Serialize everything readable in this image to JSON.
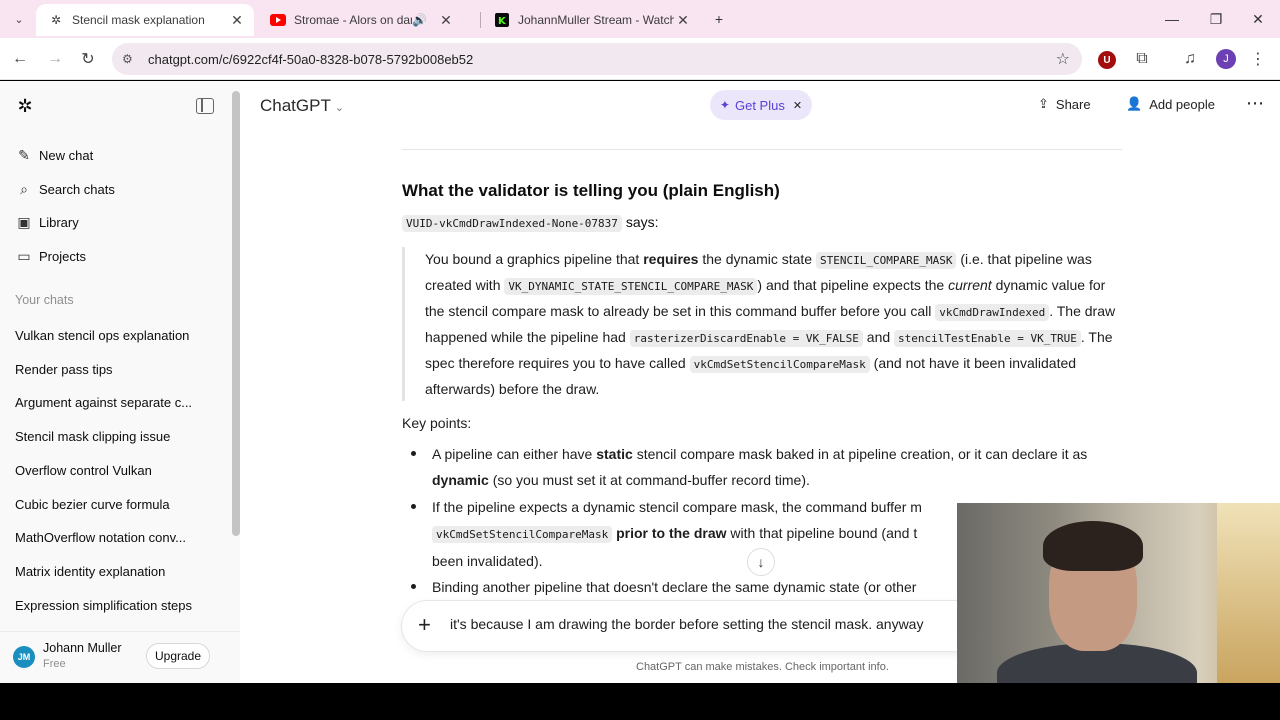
{
  "browser": {
    "tabs": [
      {
        "title": "Stencil mask explanation",
        "favicon": "chatgpt-icon",
        "active": true
      },
      {
        "title": "Stromae - Alors on danse (C",
        "favicon": "youtube-icon",
        "active": false
      },
      {
        "title": "JohannMuller Stream - Watch L",
        "favicon": "kick-icon",
        "active": false
      }
    ],
    "url": "chatgpt.com/c/6922cf4f-50a0-8328-b078-5792b008eb52",
    "profile_initial": "J",
    "extension_letter": "U"
  },
  "sidebar": {
    "items": [
      {
        "label": "New chat",
        "icon": "edit-icon"
      },
      {
        "label": "Search chats",
        "icon": "search-icon"
      },
      {
        "label": "Library",
        "icon": "library-icon"
      },
      {
        "label": "Projects",
        "icon": "folder-icon"
      }
    ],
    "section_title": "Your chats",
    "chats": [
      "Vulkan stencil ops explanation",
      "Render pass tips",
      "Argument against separate c...",
      "Stencil mask clipping issue",
      "Overflow control Vulkan",
      "Cubic bezier curve formula",
      "MathOverflow notation conv...",
      "Matrix identity explanation",
      "Expression simplification steps"
    ],
    "user": {
      "initials": "JM",
      "name": "Johann Muller",
      "plan": "Free",
      "upgrade_label": "Upgrade"
    }
  },
  "header": {
    "brand": "ChatGPT",
    "get_plus": "Get Plus",
    "share": "Share",
    "add_people": "Add people"
  },
  "message": {
    "heading": "What the validator is telling you (plain English)",
    "vuid": "VUID-vkCmdDrawIndexed-None-07837",
    "says": "says:",
    "quote": {
      "p1a": "You bound a graphics pipeline that ",
      "p1b": "requires",
      "p1c": " the dynamic state ",
      "c1": "STENCIL_COMPARE_MASK",
      "p1d": " (i.e. that pipeline was created with ",
      "c2": "VK_DYNAMIC_STATE_STENCIL_COMPARE_MASK",
      "p1e": ") and that pipeline expects the ",
      "p1f": "current",
      "p1g": " dynamic value for the stencil compare mask to already be set in this command buffer before you call ",
      "c3": "vkCmdDrawIndexed",
      "p1h": ". The draw happened while the pipeline had ",
      "c4": "rasterizerDiscardEnable = VK_FALSE",
      "p1i": " and ",
      "c5": "stencilTestEnable = VK_TRUE",
      "p1j": ". The spec therefore requires you to have called ",
      "c6": "vkCmdSetStencilCompareMask",
      "p1k": " (and not have it been invalidated afterwards) before the draw."
    },
    "key_points": "Key points:",
    "b1a": "A pipeline can either have ",
    "b1b": "static",
    "b1c": " stencil compare mask baked in at pipeline creation, or it can declare it as ",
    "b1d": "dynamic",
    "b1e": " (so you must set it at command-buffer record time).",
    "b2a": "If the pipeline expects a dynamic stencil compare mask, the command buffer m",
    "b2b": "vkCmdSetStencilCompareMask",
    "b2c": "prior to the draw",
    "b2d": " with that pipeline bound (and t",
    "b2e": "been invalidated).",
    "b3": "Binding another pipeline that doesn't declare the same dynamic state (or other"
  },
  "composer": {
    "text": "it's because I am drawing the border before setting the stencil mask. anyway"
  },
  "disclaimer": "ChatGPT can make mistakes. Check important info."
}
